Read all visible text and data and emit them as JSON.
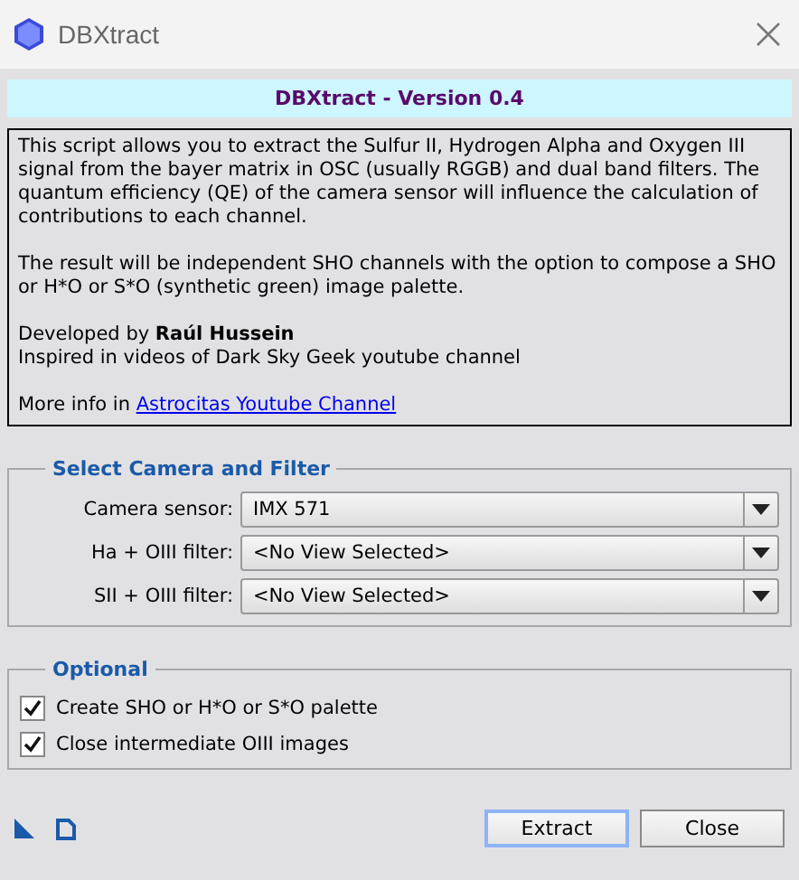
{
  "window": {
    "title": "DBXtract"
  },
  "banner": "DBXtract - Version 0.4",
  "info": {
    "paragraphs": [
      "This script allows you to extract the Sulfur II, Hydrogen Alpha and Oxygen III signal from the bayer matrix in OSC (usually RGGB) and dual band filters. The quantum efficiency (QE) of the camera sensor will influence the calculation of contributions to each channel.",
      "The result will be independent SHO channels with the option to compose a SHO or H*O or S*O (synthetic green) image palette."
    ],
    "credits": [
      "Developed by **Raúl Hussein**",
      "Inspired in videos of Dark Sky Geek youtube channel"
    ],
    "more_info": {
      "text": "More info in",
      "link": "Astrocitas Youtube Channel"
    }
  },
  "camera_group": {
    "title": "Select Camera and Filter",
    "fields": [
      {
        "label": "Camera sensor:",
        "value": "IMX 571"
      },
      {
        "label": "Ha + OIII filter:",
        "value": "<No View Selected>"
      },
      {
        "label": "SII + OIII filter:",
        "value": "<No View Selected>"
      }
    ]
  },
  "optional_group": {
    "title": "Optional",
    "options": [
      {
        "label": "Create SHO or H*O or S*O palette",
        "checked": true
      },
      {
        "label": "Close intermediate OIII images",
        "checked": true
      }
    ]
  },
  "buttons": [
    {
      "label": "Extract",
      "selected": true
    },
    {
      "label": "Close",
      "selected": false
    }
  ]
}
